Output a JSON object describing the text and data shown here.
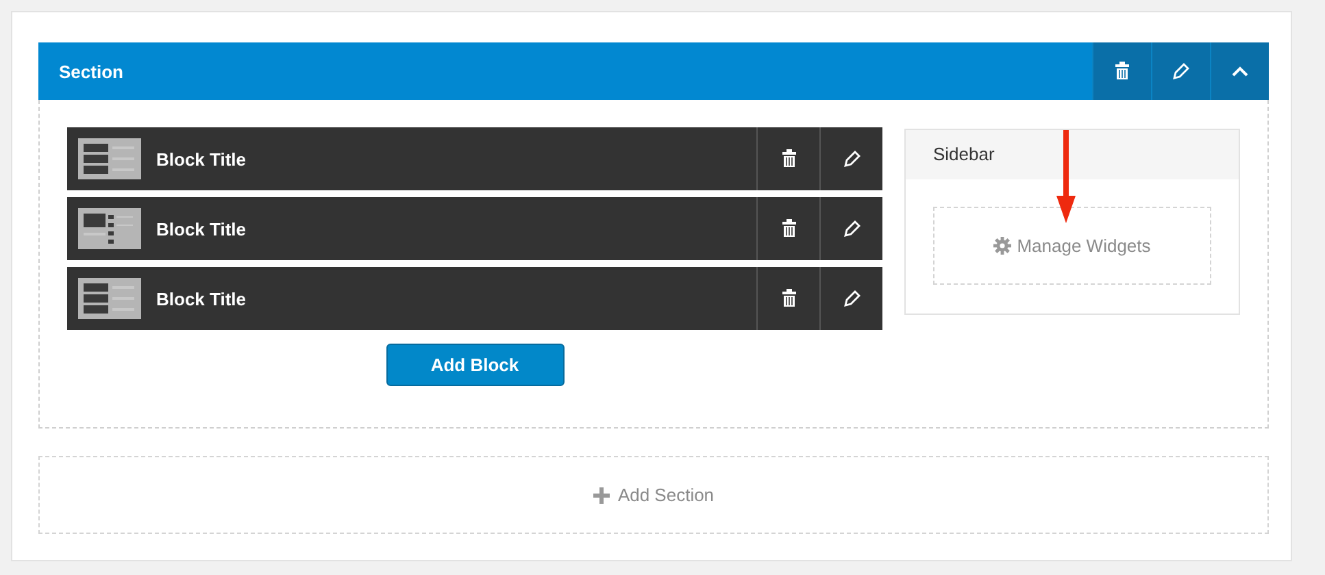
{
  "section": {
    "title": "Section",
    "expanded": true,
    "blocks": [
      {
        "title": "Block Title",
        "kind": "rows"
      },
      {
        "title": "Block Title",
        "kind": "list"
      },
      {
        "title": "Block Title",
        "kind": "rows"
      }
    ],
    "add_block": "Add Block",
    "sidebar": {
      "title": "Sidebar",
      "manage": "Manage Widgets"
    }
  },
  "add_section": "Add Section"
}
